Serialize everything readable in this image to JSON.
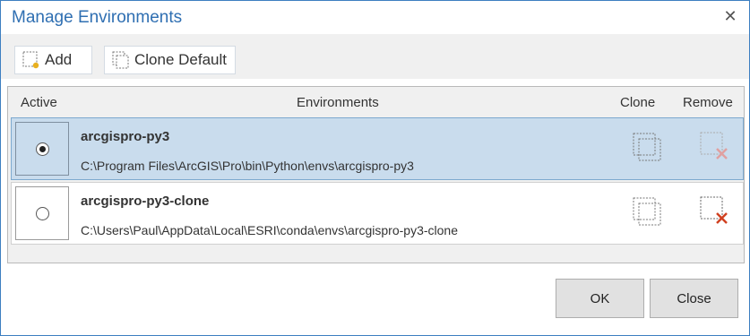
{
  "window": {
    "title": "Manage Environments",
    "close_glyph": "✕"
  },
  "toolbar": {
    "add_label": "Add",
    "clone_default_label": "Clone Default"
  },
  "grid": {
    "columns": {
      "active": "Active",
      "environments": "Environments",
      "clone": "Clone",
      "remove": "Remove"
    },
    "rows": [
      {
        "name": "arcgispro-py3",
        "path": "C:\\Program Files\\ArcGIS\\Pro\\bin\\Python\\envs\\arcgispro-py3",
        "active": true,
        "remove_enabled": false
      },
      {
        "name": "arcgispro-py3-clone",
        "path": "C:\\Users\\Paul\\AppData\\Local\\ESRI\\conda\\envs\\arcgispro-py3-clone",
        "active": false,
        "remove_enabled": true
      }
    ]
  },
  "footer": {
    "ok_label": "OK",
    "close_label": "Close"
  },
  "colors": {
    "title": "#2f6fb2",
    "selected_row": "#c9dced",
    "remove_enabled": "#d04020",
    "remove_disabled": "#e0a0a0",
    "new_star": "#e8b020"
  },
  "icons": {
    "add": "new-item-icon",
    "clone_default": "clone-icon",
    "clone": "clone-icon",
    "remove": "remove-x-icon",
    "close": "close-icon"
  }
}
